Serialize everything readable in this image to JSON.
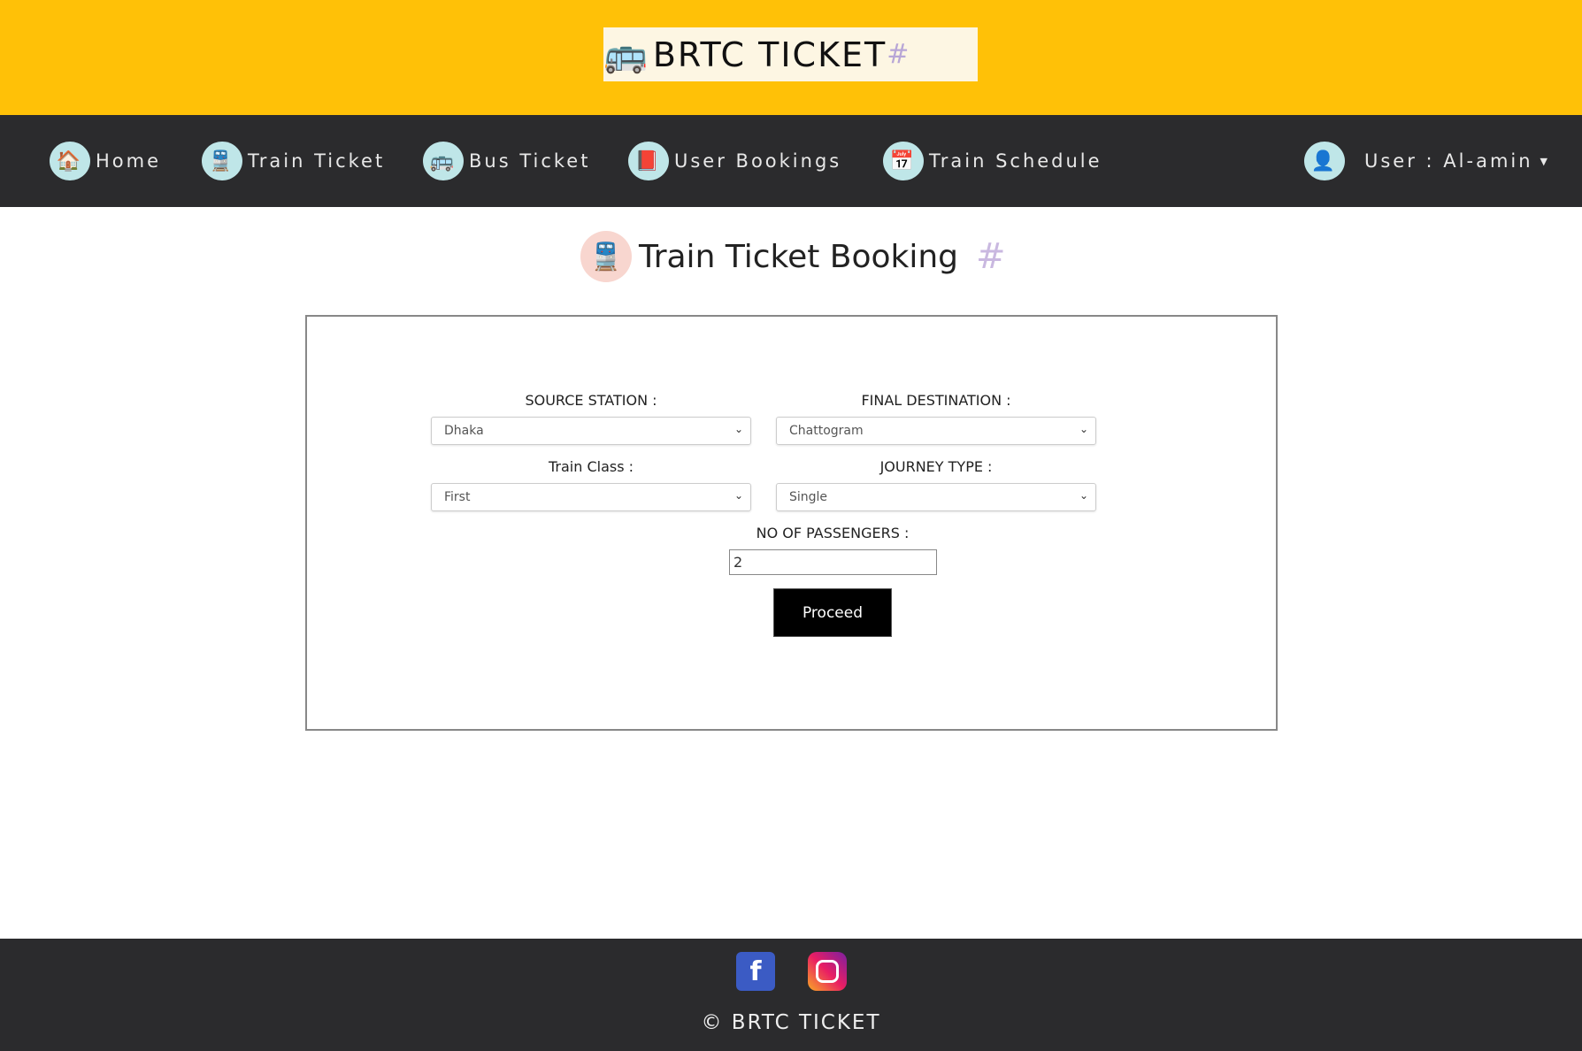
{
  "brand": {
    "title": "BRTC TICKET"
  },
  "nav": {
    "items": [
      {
        "label": "Home",
        "icon": "home-icon"
      },
      {
        "label": "Train Ticket",
        "icon": "train-icon"
      },
      {
        "label": "Bus Ticket",
        "icon": "bus-icon"
      },
      {
        "label": "User Bookings",
        "icon": "bookings-icon"
      },
      {
        "label": "Train Schedule",
        "icon": "calendar-icon"
      }
    ],
    "user": "User : Al-amin"
  },
  "page": {
    "title": "Train Ticket Booking"
  },
  "form": {
    "source_label": "SOURCE STATION :",
    "source_value": "Dhaka",
    "dest_label": "FINAL DESTINATION :",
    "dest_value": "Chattogram",
    "class_label": "Train Class :",
    "class_value": "First",
    "journey_label": "JOURNEY TYPE :",
    "journey_value": "Single",
    "passengers_label": "NO OF PASSENGERS :",
    "passengers_value": "2",
    "proceed": "Proceed"
  },
  "footer": {
    "copyright": "© BRTC TICKET"
  },
  "colors": {
    "header": "#ffc107",
    "nav": "#2b2b2d"
  }
}
